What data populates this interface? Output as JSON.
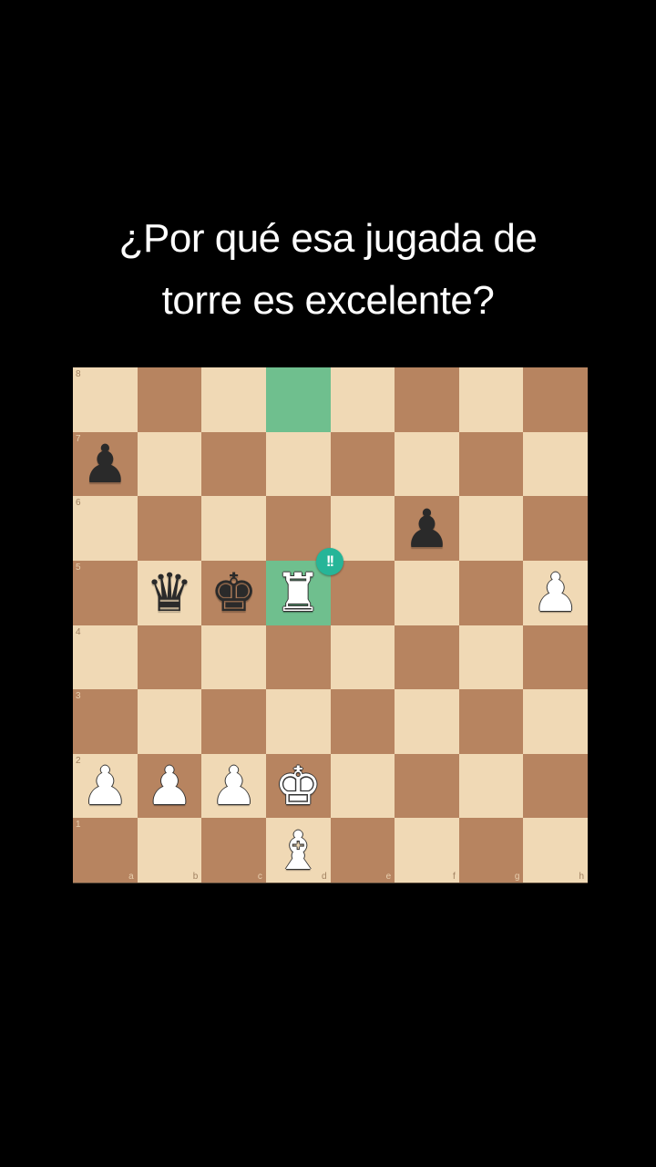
{
  "caption": {
    "line1": "¿Por qué esa jugada de",
    "line2": "torre es excelente?"
  },
  "board": {
    "files": [
      "a",
      "b",
      "c",
      "d",
      "e",
      "f",
      "g",
      "h"
    ],
    "ranks": [
      "8",
      "7",
      "6",
      "5",
      "4",
      "3",
      "2",
      "1"
    ],
    "light_color": "#f0d9b5",
    "dark_color": "#b78460",
    "highlight_color": "#6fbf8e",
    "highlighted_squares": [
      "d8",
      "d5"
    ],
    "move_badge": {
      "square": "d5",
      "text": "!!",
      "color": "#26b598"
    },
    "pieces": [
      {
        "square": "a7",
        "color": "black",
        "type": "pawn",
        "glyph": "♟"
      },
      {
        "square": "f6",
        "color": "black",
        "type": "pawn",
        "glyph": "♟"
      },
      {
        "square": "b5",
        "color": "black",
        "type": "queen",
        "glyph": "♛"
      },
      {
        "square": "c5",
        "color": "black",
        "type": "king",
        "glyph": "♚"
      },
      {
        "square": "d5",
        "color": "white",
        "type": "rook",
        "glyph": "♜"
      },
      {
        "square": "h5",
        "color": "white",
        "type": "pawn",
        "glyph": "♟"
      },
      {
        "square": "a2",
        "color": "white",
        "type": "pawn",
        "glyph": "♟"
      },
      {
        "square": "b2",
        "color": "white",
        "type": "pawn",
        "glyph": "♟"
      },
      {
        "square": "c2",
        "color": "white",
        "type": "pawn",
        "glyph": "♟"
      },
      {
        "square": "d2",
        "color": "white",
        "type": "king",
        "glyph": "♚"
      },
      {
        "square": "d1",
        "color": "white",
        "type": "bishop",
        "glyph": "♝"
      }
    ]
  }
}
